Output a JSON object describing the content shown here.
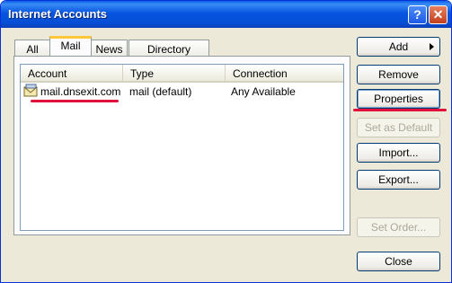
{
  "window": {
    "title": "Internet Accounts",
    "help_glyph": "?",
    "close_glyph": "✕"
  },
  "tabs": [
    {
      "label": "All"
    },
    {
      "label": "Mail"
    },
    {
      "label": "News"
    },
    {
      "label": "Directory Service"
    }
  ],
  "columns": [
    "Account",
    "Type",
    "Connection"
  ],
  "rows": [
    {
      "account": "mail.dnsexit.com",
      "type": "mail (default)",
      "connection": "Any Available",
      "icon": "mail-account-icon"
    }
  ],
  "buttons": {
    "add": "Add",
    "remove": "Remove",
    "properties": "Properties",
    "set_default": "Set as Default",
    "import": "Import...",
    "export": "Export...",
    "set_order": "Set Order...",
    "close": "Close"
  },
  "colors": {
    "title_bar": "#0754e0",
    "annotation_red": "#e0103a",
    "tab_highlight": "#ffc83c"
  }
}
